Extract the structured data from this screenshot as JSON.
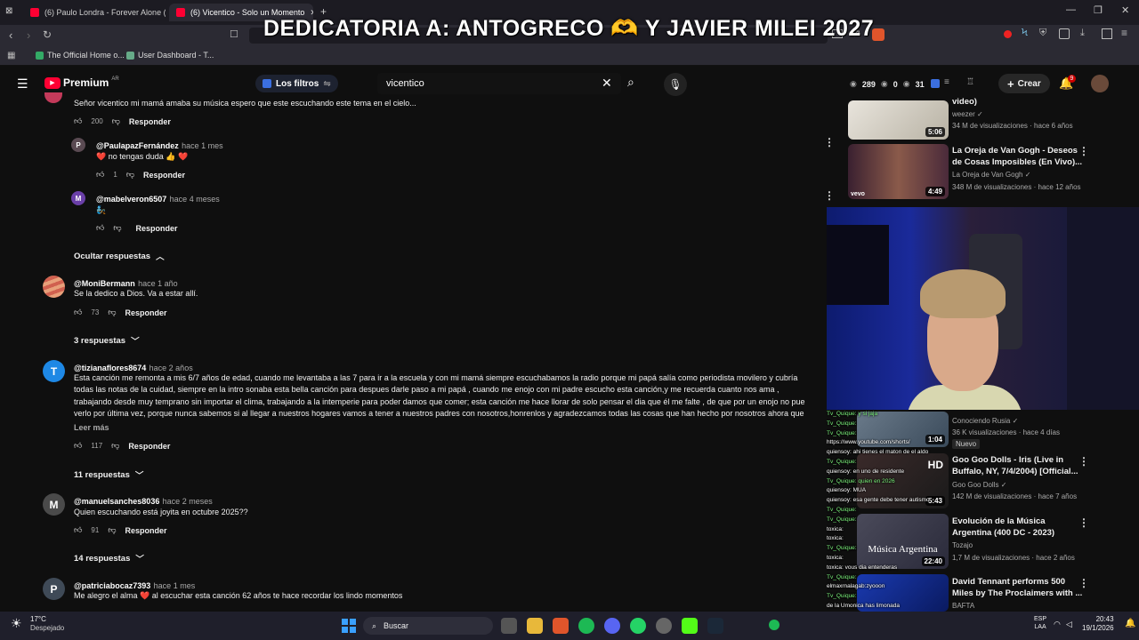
{
  "browser": {
    "tabs": [
      {
        "label": "(6) Paulo Londra - Forever Alone (Of..."
      },
      {
        "label": "(6) Vicentico - Solo un Momento"
      }
    ],
    "bookmarks": [
      {
        "label": "The Official Home o..."
      },
      {
        "label": "User Dashboard - T..."
      }
    ]
  },
  "overlay": {
    "text": "DEDICATORIA A: ANTOGRECO 🫶 Y JAVIER MILEI 2027"
  },
  "youtube": {
    "logo": "Premium",
    "region": "AR",
    "filters_label": "Los filtros",
    "search_value": "vicentico",
    "stats": {
      "a": "289",
      "b": "0",
      "c": "31"
    },
    "create_label": "Crear",
    "notif_count": "9"
  },
  "comments": {
    "top_text": "Señor vicentico mi mamá amaba su música espero que este escuchando este tema en el cielo...",
    "top_likes": "200",
    "reply_label": "Responder",
    "r1_author": "@PaulapazFernández",
    "r1_time": "hace 1 mes",
    "r1_text": "❤️ no tengas duda 👍 ❤️",
    "r1_likes": "1",
    "r1_initial": "P",
    "r2_author": "@mabelveron6507",
    "r2_time": "hace 4 meses",
    "r2_text": "🧞",
    "r2_initial": "M",
    "hide_replies": "Ocultar respuestas",
    "c1_author": "@MoniBermann",
    "c1_time": "hace 1 año",
    "c1_text": "Se la dedico a Dios.  Va a estar allí.",
    "c1_likes": "73",
    "c1_replies": "3 respuestas",
    "c2_author": "@tizianaflores8674",
    "c2_time": "hace 2 años",
    "c2_initial": "T",
    "c2_line1": "Esta canción me remonta a mis 6/7 años de edad, cuando me levantaba a las 7 para ir a la escuela y con mi mamá siempre escuchabamos la radio porque mi papá salía como periodista movilero y cubría",
    "c2_line2": "todas las notas de la cuidad, siempre en la intro sonaba esta bella canción para despues darle paso a mi papá , cuando me enojo con mi padre escucho esta canción,y me recuerda cuanto nos ama ,",
    "c2_line3": "trabajando desde muy temprano sin importar el clima, trabajando a la intemperie para poder damos que comer; esta canción me hace llorar de solo pensar el dia que él me falte , de que por un enojo no pue",
    "c2_line4": "verlo por última vez, porque nunca sabemos si al llegar a nuestros hogares vamos a tener a nuestros padres con nosotros,honrenlos y agradezcamos todas las cosas que han hecho por nosotros ahora que",
    "read_more": "Leer más",
    "c2_likes": "117",
    "c2_replies": "11 respuestas",
    "c3_author": "@manuelsanches8036",
    "c3_time": "hace 2 meses",
    "c3_initial": "M",
    "c3_text": "Quien escuchando está joyita en octubre 2025??",
    "c3_likes": "91",
    "c3_replies": "14 respuestas",
    "c4_author": "@patriciabocaz7393",
    "c4_time": "hace 1 mes",
    "c4_initial": "P",
    "c4_text": "Me alegro el alma ❤️ al escuchar esta canción 62 años te hace recordar los lindo momentos"
  },
  "sidebar": {
    "v0_title": "video)",
    "v0_channel": "weezer",
    "v0_meta": "34 M de visualizaciones · hace 6 años",
    "v0_dur": "5:06",
    "v1_title_a": "La Oreja de Van Gogh - Deseos",
    "v1_title_b": "de Cosas Imposibles (En Vivo)...",
    "v1_channel": "La Oreja de Van Gogh",
    "v1_meta": "348 M de visualizaciones · hace 12 años",
    "v1_dur": "4:49",
    "v1_badge": "vevo",
    "v2_channel": "Conociendo Rusia",
    "v2_meta": "36 K visualizaciones · hace 4 días",
    "v2_new": "Nuevo",
    "v2_dur": "1:04",
    "v3_title_a": "Goo Goo Dolls - Iris (Live in",
    "v3_title_b": "Buffalo, NY, 7/4/2004) [Official...",
    "v3_channel": "Goo Goo Dolls",
    "v3_meta": "142 M de visualizaciones · hace 7 años",
    "v3_dur": "5:43",
    "v3_hd": "HD",
    "v4_title_a": "Evolución de la Música",
    "v4_title_b": "Argentina (400 DC - 2023)",
    "v4_channel": "Tozajo",
    "v4_meta": "1,7 M de visualizaciones · hace 2 años",
    "v4_dur": "22:40",
    "v4_thumb_text": "Música Argentina",
    "v5_title_a": "David Tennant performs 500",
    "v5_title_b": "Miles by The Proclaimers with ...",
    "v5_channel": "BAFTA"
  },
  "chat": {
    "lines": [
      "Tv_Quique: y si jaja",
      "Tv_Quique: ",
      "Tv_Quique:",
      "https://www.youtube.com/shorts/",
      "quiensoy: ahi tienes el maton de el aldo",
      "Tv_Quique: ",
      "quiensoy: en uno de residente",
      "Tv_Quique: quien en 2026",
      "quiensoy: MUA",
      "quiensoy: esa gente debe tener autismo",
      "Tv_Quique: ",
      "Tv_Quique: ",
      "toxica: ",
      "toxica: ",
      "Tv_Quique: ",
      "toxica: ",
      "toxica: vous dia entenderas",
      "Tv_Quique: ",
      "elmaxrnalagab:zyooon",
      "Tv_Quique: "
    ],
    "bottom_text": "de la Umonica has limonada"
  },
  "taskbar": {
    "weather_temp": "17°C",
    "weather_desc": "Despejado",
    "search_label": "Buscar",
    "lang": "ESP",
    "lang2": "LAA",
    "time": "20:43",
    "date": "19/1/2026"
  }
}
